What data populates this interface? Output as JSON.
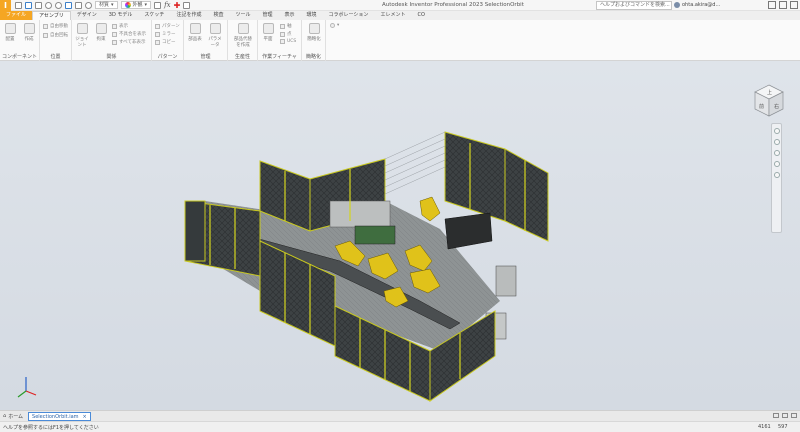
{
  "app": {
    "logo_letter": "I",
    "title": "Autodesk Inventor Professional 2023   SelectionOrbit",
    "help_search_placeholder": "ヘルプおよびコマンドを検索...",
    "user_name": "ohta.akira@d...",
    "accent": "#f5a623"
  },
  "quick_access": {
    "material_combo": "材質",
    "appearance_combo": "外観"
  },
  "tabs": [
    "ファイル",
    "アセンブリ",
    "デザイン",
    "3D モデル",
    "スケッチ",
    "注記を作成",
    "検査",
    "ツール",
    "管理",
    "表示",
    "環境",
    "コラボレーション",
    "エレメント",
    "CO"
  ],
  "active_tab_index": 1,
  "ribbon": {
    "panels": [
      {
        "title": "コンポーネント",
        "buttons": [
          "配置",
          "作成"
        ],
        "small": []
      },
      {
        "title": "位置",
        "buttons": [],
        "small": [
          "自由移動",
          "自由回転"
        ]
      },
      {
        "title": "関係",
        "buttons": [
          "ジョイント",
          "拘束"
        ],
        "small": [
          "表示",
          "不具合を表示",
          "すべて非表示"
        ]
      },
      {
        "title": "パターン",
        "buttons": [],
        "small": [
          "パターン",
          "ミラー",
          "コピー"
        ]
      },
      {
        "title": "管理",
        "buttons": [
          "部品表",
          "パラメータ"
        ],
        "small": []
      },
      {
        "title": "生産性",
        "buttons": [
          "部品代替を作成"
        ],
        "small": []
      },
      {
        "title": "作業フィーチャ",
        "buttons": [
          "平面"
        ],
        "small": [
          "軸",
          "点",
          "UCS"
        ]
      },
      {
        "title": "簡略化",
        "buttons": [
          "簡略化"
        ],
        "small": []
      }
    ]
  },
  "viewcube": {
    "top_label": "上",
    "front_label": "前",
    "right_label": "右"
  },
  "document_tabs": {
    "home_label": "ホーム",
    "active_doc": "SelectionOrbit.iam",
    "close_glyph": "×"
  },
  "status": {
    "message": "ヘルプを参照するにはF1を押してください",
    "count_a": "4161",
    "count_b": "597"
  }
}
